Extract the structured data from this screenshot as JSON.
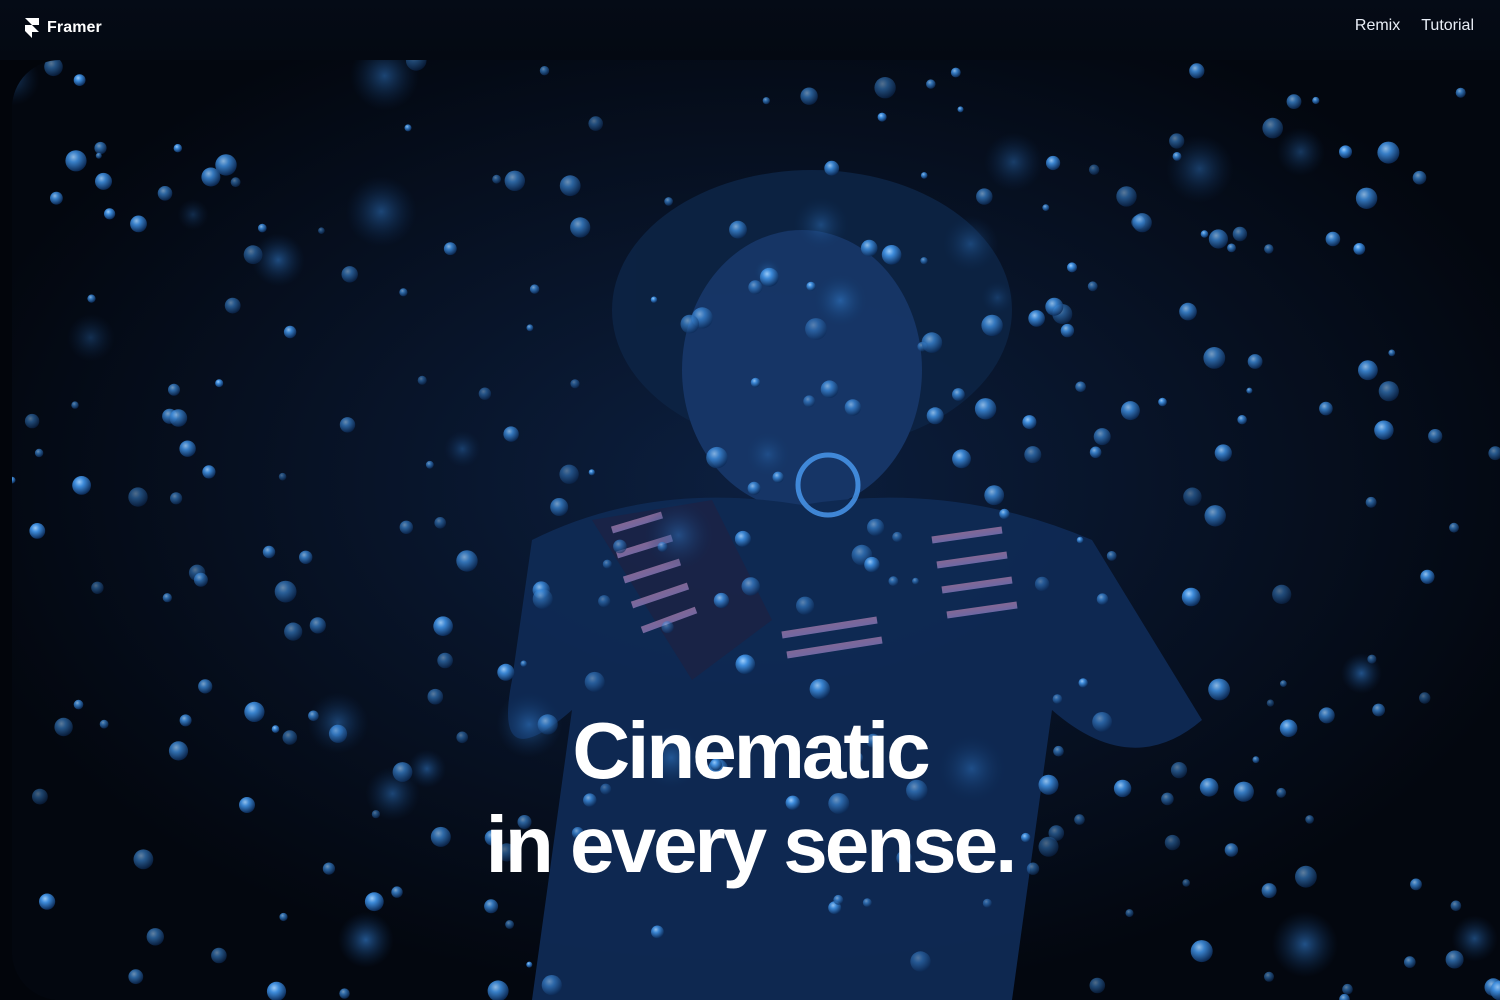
{
  "header": {
    "brand_name": "Framer",
    "brand_icon": "framer-logo-icon",
    "nav": [
      {
        "label": "Remix"
      },
      {
        "label": "Tutorial"
      }
    ]
  },
  "hero": {
    "headline_line1": "Cinematic",
    "headline_line2": "in every sense.",
    "media": "background-video",
    "colors": {
      "background": "#02050b",
      "bubble": "#3f8fe0",
      "text": "#ffffff"
    }
  }
}
